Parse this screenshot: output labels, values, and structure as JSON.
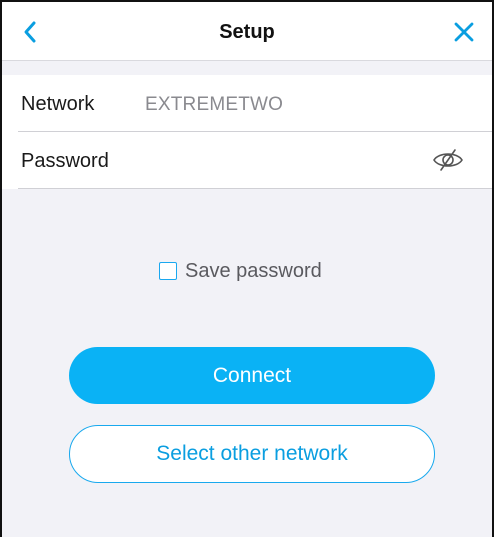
{
  "header": {
    "title": "Setup",
    "back_icon": "chevron-left-icon",
    "close_icon": "close-icon"
  },
  "form": {
    "network_label": "Network",
    "network_value": "EXTREMETWO",
    "password_label": "Password",
    "password_value": "",
    "visibility_icon": "eye-slash-icon"
  },
  "save_password": {
    "label": "Save password",
    "checked": false
  },
  "buttons": {
    "connect": "Connect",
    "select_other": "Select other network"
  },
  "colors": {
    "accent": "#0ab2f5",
    "background": "#f2f2f7"
  }
}
